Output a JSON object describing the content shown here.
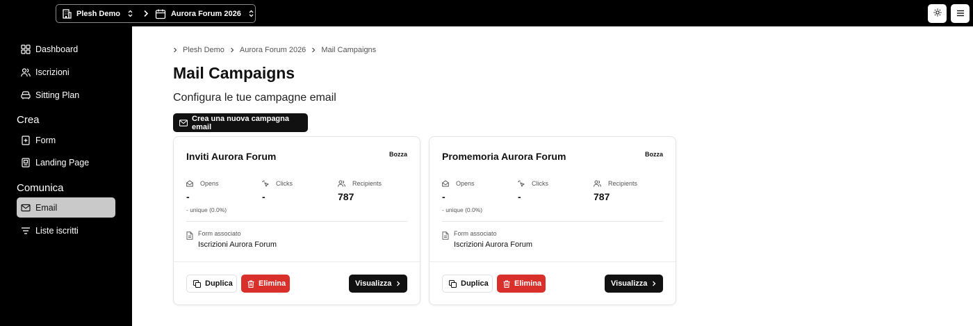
{
  "topbar": {
    "org": "Plesh Demo",
    "event": "Aurora Forum 2026",
    "theme_icon": "sun-icon",
    "menu_icon": "menu-icon"
  },
  "sidebar": {
    "items_top": [
      {
        "label": "Dashboard",
        "icon": "grid-icon"
      },
      {
        "label": "Iscrizioni",
        "icon": "users-icon"
      },
      {
        "label": "Sitting Plan",
        "icon": "sofa-icon"
      }
    ],
    "section_crea": "Crea",
    "items_crea": [
      {
        "label": "Form",
        "icon": "file-plus-icon"
      },
      {
        "label": "Landing Page",
        "icon": "page-icon"
      }
    ],
    "section_comunica": "Comunica",
    "items_comunica": [
      {
        "label": "Email",
        "icon": "mail-icon"
      },
      {
        "label": "Liste iscritti",
        "icon": "list-filter-icon"
      }
    ],
    "accent_active": "#c9c9c9"
  },
  "breadcrumbs": [
    "Plesh Demo",
    "Aurora Forum 2026",
    "Mail Campaigns"
  ],
  "page": {
    "title": "Mail Campaigns",
    "subtitle": "Configura le tue campagne email",
    "new_button": "Crea una nuova campagna email"
  },
  "labels": {
    "opens": "Opens",
    "clicks": "Clicks",
    "recipients": "Recipients",
    "form_assoc": "Form associato",
    "duplicate": "Duplica",
    "delete": "Elimina",
    "view": "Visualizza"
  },
  "campaigns": [
    {
      "title": "Inviti Aurora Forum",
      "status": "Bozza",
      "opens": "-",
      "opens_unique": "- unique (0.0%)",
      "clicks": "-",
      "recipients": "787",
      "form": "Iscrizioni Aurora Forum"
    },
    {
      "title": "Promemoria Aurora Forum",
      "status": "Bozza",
      "opens": "-",
      "opens_unique": "- unique (0.0%)",
      "clicks": "-",
      "recipients": "787",
      "form": "Iscrizioni Aurora Forum"
    }
  ],
  "colors": {
    "danger": "#d9302c",
    "primary": "#111111"
  }
}
